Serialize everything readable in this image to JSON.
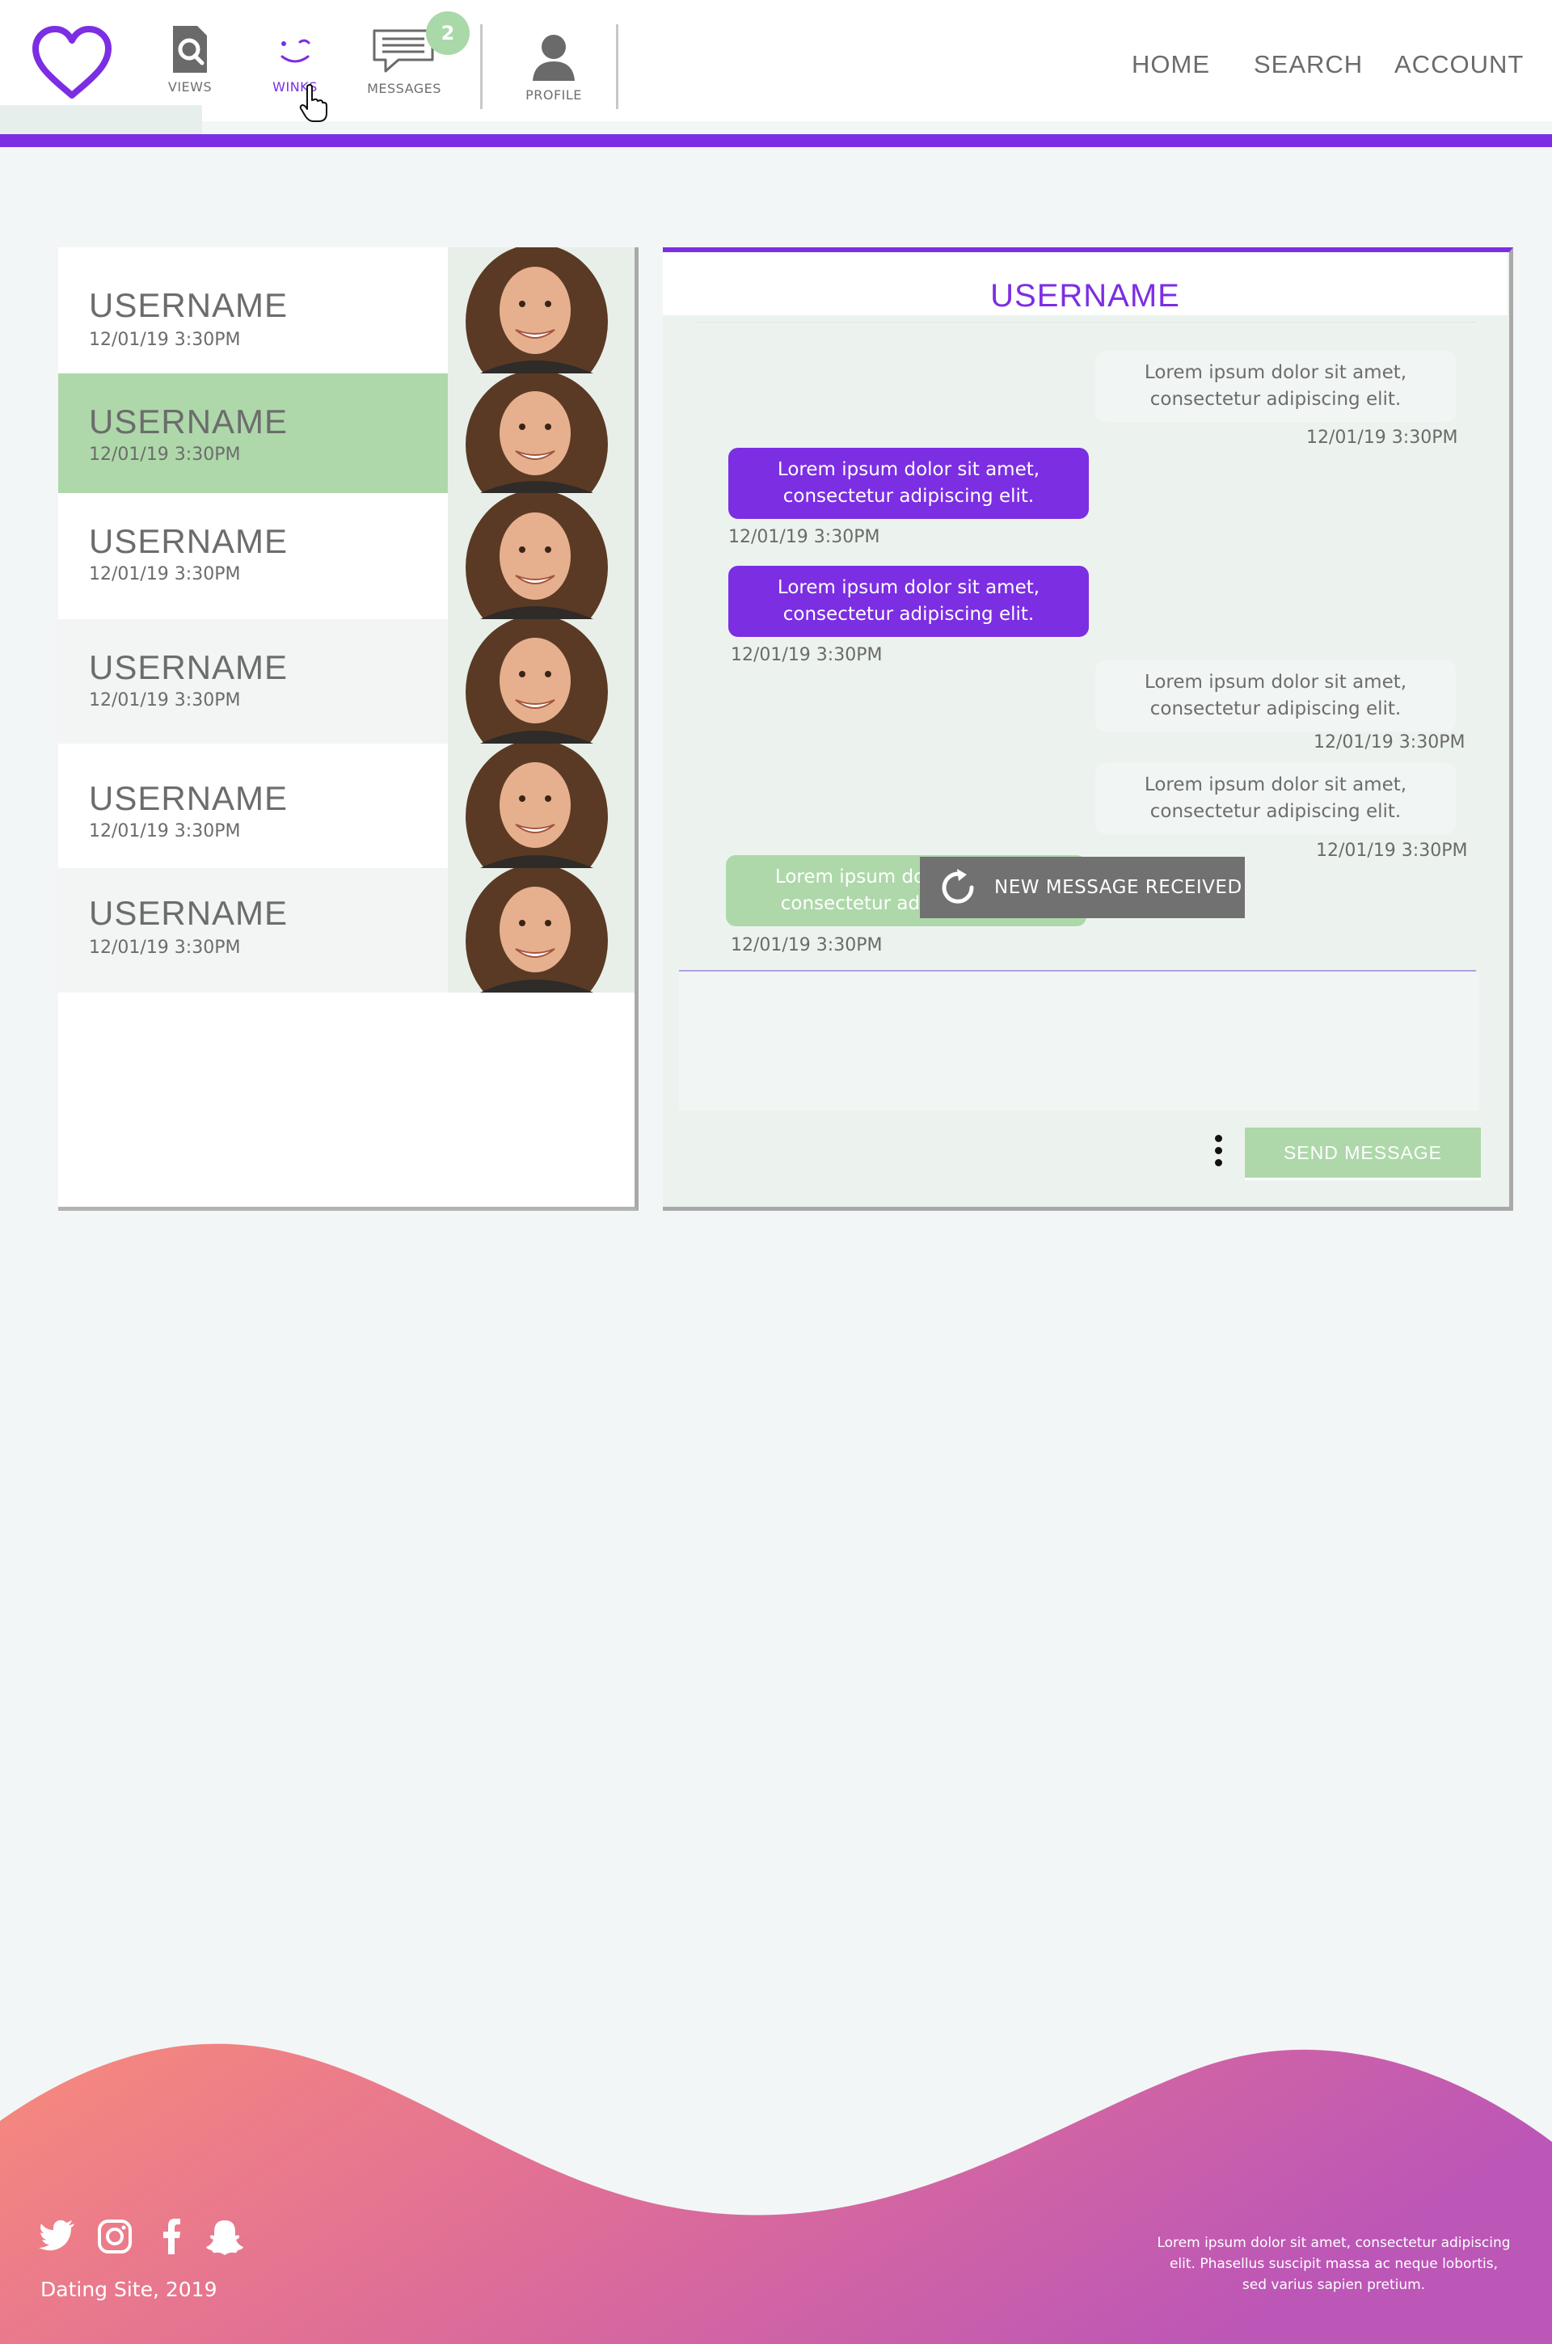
{
  "header": {
    "nav_icons": {
      "views_label": "VIEWS",
      "winks_label": "WINKS",
      "messages_label": "MESSAGES",
      "messages_badge": "2",
      "profile_label": "PROFILE"
    },
    "top_nav": {
      "home": "HOME",
      "search": "SEARCH",
      "account": "ACCOUNT"
    }
  },
  "conversations": [
    {
      "username": "USERNAME",
      "time": "12/01/19 3:30PM"
    },
    {
      "username": "USERNAME",
      "time": "12/01/19 3:30PM",
      "selected": true
    },
    {
      "username": "USERNAME",
      "time": "12/01/19 3:30PM"
    },
    {
      "username": "USERNAME",
      "time": "12/01/19 3:30PM"
    },
    {
      "username": "USERNAME",
      "time": "12/01/19 3:30PM"
    },
    {
      "username": "USERNAME",
      "time": "12/01/19 3:30PM"
    }
  ],
  "chat": {
    "title": "USERNAME",
    "messages": [
      {
        "direction": "in",
        "text": "Lorem ipsum dolor sit amet, consectetur adipiscing elit.",
        "time": "12/01/19 3:30PM"
      },
      {
        "direction": "out",
        "text": "Lorem ipsum dolor sit amet, consectetur adipiscing elit.",
        "time": "12/01/19 3:30PM"
      },
      {
        "direction": "out",
        "text": "Lorem ipsum dolor sit amet, consectetur adipiscing elit.",
        "time": "12/01/19 3:30PM"
      },
      {
        "direction": "in",
        "text": "Lorem ipsum dolor sit amet, consectetur adipiscing elit.",
        "time": "12/01/19 3:30PM"
      },
      {
        "direction": "in",
        "text": "Lorem ipsum dolor sit amet, consectetur adipiscing elit.",
        "time": "12/01/19 3:30PM"
      },
      {
        "direction": "pending",
        "text": "Lorem ipsum dolor sit amet, consectetur adipiscing elit.",
        "time": "12/01/19 3:30PM"
      }
    ],
    "toast": "NEW MESSAGE RECEIVED",
    "send_label": "SEND MESSAGE"
  },
  "footer": {
    "copyright": "Dating Site, 2019",
    "blurb": "Lorem ipsum dolor sit amet, consectetur adipiscing elit. Phasellus suscipit massa ac neque lobortis, sed varius sapien pretium."
  },
  "colors": {
    "accent": "#7c2ee3",
    "green": "#aed8aa",
    "footer_start": "#f88a7c",
    "footer_end": "#bc56b7"
  },
  "icons": [
    "heart-logo-icon",
    "views-search-icon",
    "wink-icon",
    "messages-icon",
    "profile-icon",
    "hand-cursor-icon",
    "refresh-icon",
    "kebab-menu-icon",
    "twitter-icon",
    "instagram-icon",
    "facebook-icon",
    "snapchat-icon"
  ]
}
